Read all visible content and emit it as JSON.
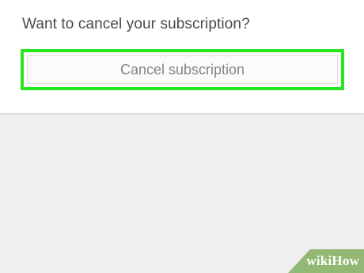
{
  "subscription": {
    "question": "Want to cancel your subscription?",
    "cancel_button_label": "Cancel subscription"
  },
  "watermark": {
    "text": "wikiHow"
  },
  "colors": {
    "highlight": "#27e51e",
    "background": "#efeff1",
    "card": "#ffffff",
    "watermark": "#93b874"
  }
}
